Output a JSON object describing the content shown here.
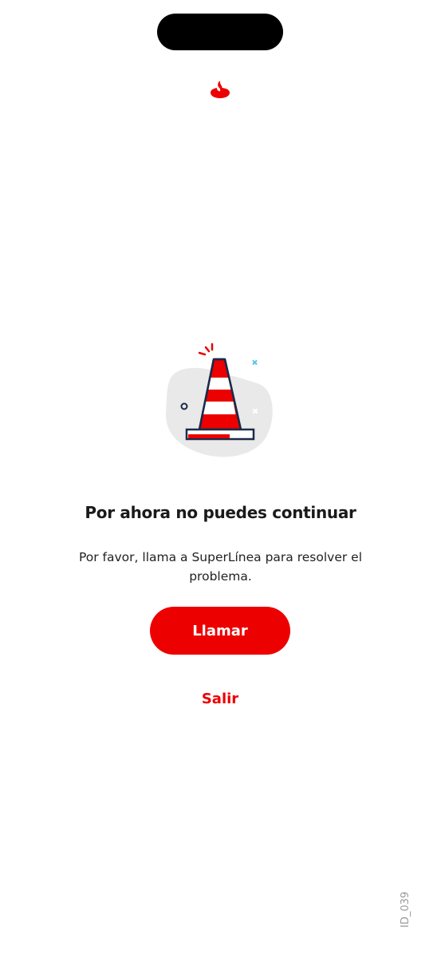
{
  "status_bar": {},
  "header": {
    "logo_icon": "santander-flame-icon"
  },
  "illustration": {
    "icon": "traffic-cone-icon"
  },
  "content": {
    "title": "Por ahora no puedes continuar",
    "message": "Por favor, llama a SuperLínea para resolver el problema."
  },
  "actions": {
    "call_label": "Llamar",
    "exit_label": "Salir"
  },
  "footer": {
    "screen_id": "ID_039"
  },
  "colors": {
    "brand_red": "#ec0000",
    "blob_gray": "#e9e9e9",
    "outline_navy": "#1b2a4a",
    "accent_blue": "#5bc6e8"
  }
}
